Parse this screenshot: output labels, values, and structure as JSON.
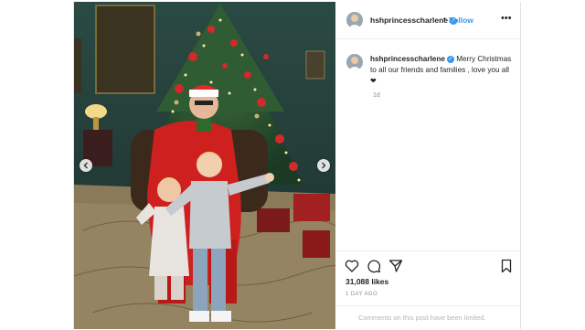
{
  "post": {
    "username": "hshprincesscharlene",
    "follow_label": "Follow",
    "separator": "•",
    "caption": "Merry Christmas to all our friends and families , love you all ❤",
    "caption_time": "1d",
    "likes": "31,088 likes",
    "posted_ago": "1 DAY AGO",
    "comments_limited": "Comments on this post have been limited."
  },
  "icons": {
    "verified": "verified-badge-icon",
    "more": "more-options-icon",
    "like": "heart-icon",
    "comment": "comment-bubble-icon",
    "share": "paper-plane-icon",
    "save": "bookmark-icon",
    "prev": "chevron-left-icon",
    "next": "chevron-right-icon"
  },
  "colors": {
    "link_blue": "#3897f0",
    "text_dark": "#262626",
    "text_muted": "#8e8e8e"
  }
}
